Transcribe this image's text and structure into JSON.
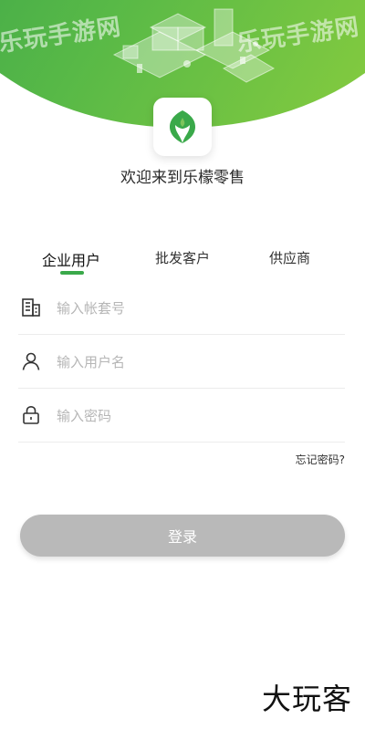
{
  "header": {
    "welcome_text": "欢迎来到乐檬零售",
    "watermark_left": "乐玩手游网",
    "watermark_right": "乐玩手游网"
  },
  "tabs": [
    {
      "label": "企业用户",
      "active": true
    },
    {
      "label": "批发客户",
      "active": false
    },
    {
      "label": "供应商",
      "active": false
    }
  ],
  "form": {
    "account_placeholder": "输入帐套号",
    "username_placeholder": "输入用户名",
    "password_placeholder": "输入密码",
    "forgot_label": "忘记密码?",
    "login_label": "登录"
  },
  "footer": {
    "watermark": "大玩客"
  },
  "colors": {
    "accent": "#3aa94a",
    "button_disabled": "#b9b9b9"
  }
}
